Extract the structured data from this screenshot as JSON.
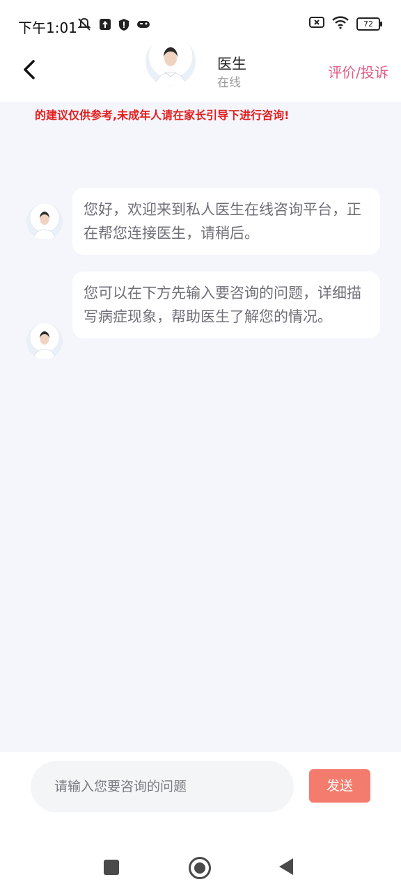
{
  "status_bar": {
    "time": "下午1:01",
    "battery": "72"
  },
  "header": {
    "doctor_name": "医生",
    "doctor_status": "在线",
    "review_label": "评价/投诉"
  },
  "notice": "的建议仅供参考,未成年人请在家长引导下进行咨询!",
  "messages": [
    {
      "text": "您好，欢迎来到私人医生在线咨询平台，正在帮您连接医生，请稍后。"
    },
    {
      "text": "您可以在下方先输入要咨询的问题，详细描写病症现象，帮助医生了解您的情况。"
    }
  ],
  "composer": {
    "placeholder": "请输入您要咨询的问题",
    "send_label": "发送"
  },
  "icons": {
    "back": "chevron-left-icon",
    "mute": "bell-off-icon",
    "upload": "upload-icon",
    "shield": "shield-icon",
    "game": "gamepad-icon",
    "sim": "sim-off-icon",
    "wifi": "wifi-icon"
  },
  "colors": {
    "accent": "#e15c86",
    "send": "#f47c6e",
    "notice": "#e21d1d",
    "chat_bg": "#f5f6fc"
  }
}
